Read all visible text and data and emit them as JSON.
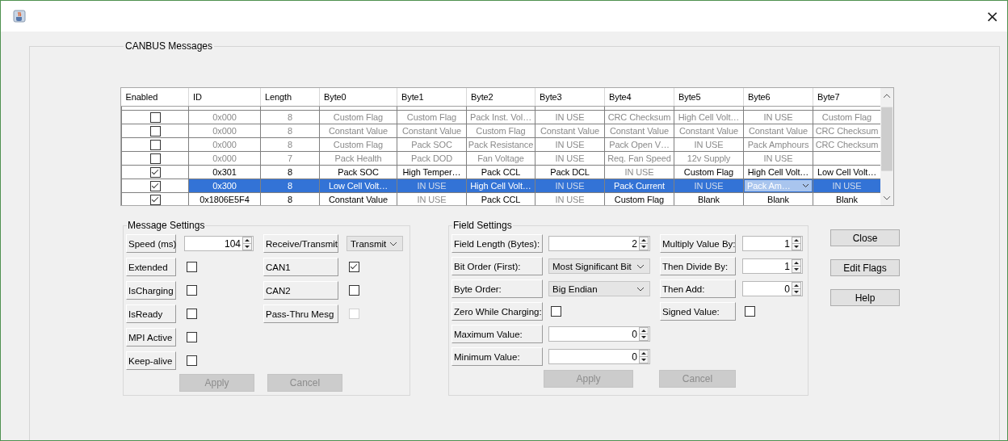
{
  "window": {
    "close": "×"
  },
  "panel": {
    "title": "CANBUS Messages"
  },
  "table": {
    "columns": [
      "Enabled",
      "ID",
      "Length",
      "Byte0",
      "Byte1",
      "Byte2",
      "Byte3",
      "Byte4",
      "Byte5",
      "Byte6",
      "Byte7"
    ],
    "rows": [
      {
        "enabled": false,
        "selected": false,
        "id": "0x000",
        "length": "8",
        "bytes": [
          {
            "text": "Custom Flag",
            "kind": "value"
          },
          {
            "text": "Custom Flag",
            "kind": "value"
          },
          {
            "text": "Pack Inst. Vol…",
            "kind": "value"
          },
          {
            "text": "IN USE",
            "kind": "in_use"
          },
          {
            "text": "CRC Checksum",
            "kind": "value"
          },
          {
            "text": "High Cell Volt…",
            "kind": "value"
          },
          {
            "text": "IN USE",
            "kind": "in_use"
          },
          {
            "text": "Custom Flag",
            "kind": "value"
          }
        ]
      },
      {
        "enabled": false,
        "selected": false,
        "id": "0x000",
        "length": "8",
        "bytes": [
          {
            "text": "Constant Value",
            "kind": "value"
          },
          {
            "text": "Constant Value",
            "kind": "value"
          },
          {
            "text": "Custom Flag",
            "kind": "value"
          },
          {
            "text": "Constant Value",
            "kind": "value"
          },
          {
            "text": "Constant Value",
            "kind": "value"
          },
          {
            "text": "Constant Value",
            "kind": "value"
          },
          {
            "text": "Constant Value",
            "kind": "value"
          },
          {
            "text": "CRC Checksum",
            "kind": "value"
          }
        ]
      },
      {
        "enabled": false,
        "selected": false,
        "id": "0x000",
        "length": "8",
        "bytes": [
          {
            "text": "Custom Flag",
            "kind": "value"
          },
          {
            "text": "Pack SOC",
            "kind": "value"
          },
          {
            "text": "Pack Resistance",
            "kind": "value"
          },
          {
            "text": "IN USE",
            "kind": "in_use"
          },
          {
            "text": "Pack Open V…",
            "kind": "value"
          },
          {
            "text": "IN USE",
            "kind": "in_use"
          },
          {
            "text": "Pack Amphours",
            "kind": "value"
          },
          {
            "text": "CRC Checksum",
            "kind": "value"
          }
        ]
      },
      {
        "enabled": false,
        "selected": false,
        "id": "0x000",
        "length": "7",
        "bytes": [
          {
            "text": "Pack Health",
            "kind": "value"
          },
          {
            "text": "Pack DOD",
            "kind": "value"
          },
          {
            "text": "Fan Voltage",
            "kind": "value"
          },
          {
            "text": "IN USE",
            "kind": "in_use"
          },
          {
            "text": "Req. Fan Speed",
            "kind": "value"
          },
          {
            "text": "12v Supply",
            "kind": "value"
          },
          {
            "text": "IN USE",
            "kind": "in_use"
          },
          {
            "kind": "empty"
          }
        ]
      },
      {
        "enabled": true,
        "selected": false,
        "id": "0x301",
        "length": "8",
        "bytes": [
          {
            "text": "Pack SOC",
            "kind": "value"
          },
          {
            "text": "High Temper…",
            "kind": "value"
          },
          {
            "text": "Pack CCL",
            "kind": "value"
          },
          {
            "text": "Pack DCL",
            "kind": "value"
          },
          {
            "text": "IN USE",
            "kind": "in_use"
          },
          {
            "text": "Custom Flag",
            "kind": "value"
          },
          {
            "text": "High Cell Volt…",
            "kind": "value"
          },
          {
            "text": "Low Cell Volt…",
            "kind": "value"
          }
        ]
      },
      {
        "enabled": true,
        "selected": true,
        "id": "0x300",
        "length": "8",
        "bytes": [
          {
            "text": "Low Cell Volt…",
            "kind": "value"
          },
          {
            "text": "IN USE",
            "kind": "in_use"
          },
          {
            "text": "High Cell Volt…",
            "kind": "value"
          },
          {
            "text": "IN USE",
            "kind": "in_use"
          },
          {
            "text": "Pack Current",
            "kind": "value"
          },
          {
            "text": "IN USE",
            "kind": "in_use"
          },
          {
            "text": "Pack Am…",
            "kind": "editor"
          },
          {
            "text": "IN USE",
            "kind": "in_use"
          }
        ]
      },
      {
        "enabled": true,
        "selected": false,
        "id": "0x1806E5F4",
        "length": "8",
        "bytes": [
          {
            "text": "Constant Value",
            "kind": "value"
          },
          {
            "text": "IN USE",
            "kind": "in_use"
          },
          {
            "text": "Pack CCL",
            "kind": "value"
          },
          {
            "text": "IN USE",
            "kind": "in_use"
          },
          {
            "text": "Custom Flag",
            "kind": "value"
          },
          {
            "text": "Blank",
            "kind": "value"
          },
          {
            "text": "Blank",
            "kind": "value"
          },
          {
            "text": "Blank",
            "kind": "value"
          }
        ]
      }
    ]
  },
  "message_settings": {
    "title": "Message Settings",
    "left": [
      {
        "label": "Speed (ms)",
        "kind": "spinner",
        "value": "104"
      },
      {
        "label": "Extended",
        "kind": "checkbox",
        "checked": false,
        "disabled": false
      },
      {
        "label": "IsCharging",
        "kind": "checkbox",
        "checked": false,
        "disabled": false
      },
      {
        "label": "IsReady",
        "kind": "checkbox",
        "checked": false,
        "disabled": false
      },
      {
        "label": "MPI Active",
        "kind": "checkbox",
        "checked": false,
        "disabled": false
      },
      {
        "label": "Keep-alive",
        "kind": "checkbox",
        "checked": false,
        "disabled": false
      }
    ],
    "right": [
      {
        "label": "Receive/Transmit",
        "kind": "combo",
        "value": "Transmit"
      },
      {
        "label": "CAN1",
        "kind": "checkbox",
        "checked": true,
        "disabled": false
      },
      {
        "label": "CAN2",
        "kind": "checkbox",
        "checked": false,
        "disabled": false
      },
      {
        "label": "Pass-Thru Mesg",
        "kind": "checkbox",
        "checked": false,
        "disabled": true
      }
    ],
    "buttons": [
      {
        "label": "Apply",
        "disabled": true
      },
      {
        "label": "Cancel",
        "disabled": true
      }
    ]
  },
  "field_settings": {
    "title": "Field Settings",
    "left": [
      {
        "label": "Field Length (Bytes):",
        "kind": "spinner",
        "value": "2"
      },
      {
        "label": "Bit Order (First):",
        "kind": "combo",
        "value": "Most Significant Bit"
      },
      {
        "label": "Byte Order:",
        "kind": "combo",
        "value": "Big Endian"
      },
      {
        "label": "Zero While Charging:",
        "kind": "checkbox",
        "checked": false,
        "disabled": false
      },
      {
        "label": "Maximum Value:",
        "kind": "spinner",
        "value": "0"
      },
      {
        "label": "Minimum Value:",
        "kind": "spinner",
        "value": "0"
      }
    ],
    "right": [
      {
        "label": "Multiply Value By:",
        "kind": "spinner",
        "value": "1"
      },
      {
        "label": "Then Divide By:",
        "kind": "spinner",
        "value": "1"
      },
      {
        "label": "Then Add:",
        "kind": "spinner",
        "value": "0"
      },
      {
        "label": "Signed Value:",
        "kind": "checkbox",
        "checked": false,
        "disabled": false
      }
    ],
    "buttons": [
      {
        "label": "Apply",
        "disabled": true
      },
      {
        "label": "Cancel",
        "disabled": true
      }
    ]
  },
  "side_buttons": [
    {
      "label": "Close"
    },
    {
      "label": "Edit Flags"
    },
    {
      "label": "Help"
    }
  ]
}
